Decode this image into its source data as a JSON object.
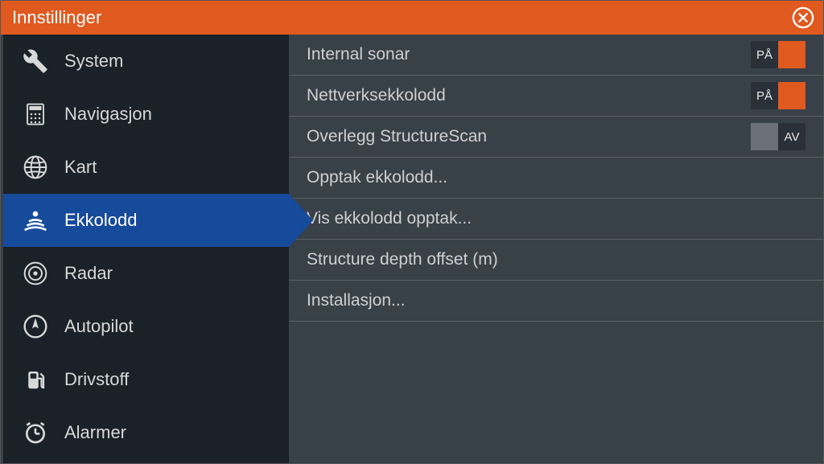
{
  "window": {
    "title": "Innstillinger"
  },
  "sidebar": {
    "items": [
      {
        "label": "System",
        "icon": "wrench"
      },
      {
        "label": "Navigasjon",
        "icon": "calculator"
      },
      {
        "label": "Kart",
        "icon": "globe"
      },
      {
        "label": "Ekkolodd",
        "icon": "sonar"
      },
      {
        "label": "Radar",
        "icon": "radar"
      },
      {
        "label": "Autopilot",
        "icon": "compass"
      },
      {
        "label": "Drivstoff",
        "icon": "fuel"
      },
      {
        "label": "Alarmer",
        "icon": "alarm"
      }
    ],
    "selected_index": 3
  },
  "settings": {
    "toggle_on": "PÅ",
    "toggle_off": "AV",
    "rows": [
      {
        "label": "Internal sonar",
        "type": "toggle",
        "value": true
      },
      {
        "label": "Nettverksekkolodd",
        "type": "toggle",
        "value": true
      },
      {
        "label": "Overlegg StructureScan",
        "type": "toggle",
        "value": false
      },
      {
        "label": "Opptak ekkolodd...",
        "type": "link"
      },
      {
        "label": "Vis ekkolodd opptak...",
        "type": "link"
      },
      {
        "label": "Structure depth offset (m)",
        "type": "link"
      },
      {
        "label": "Installasjon...",
        "type": "link"
      }
    ]
  }
}
